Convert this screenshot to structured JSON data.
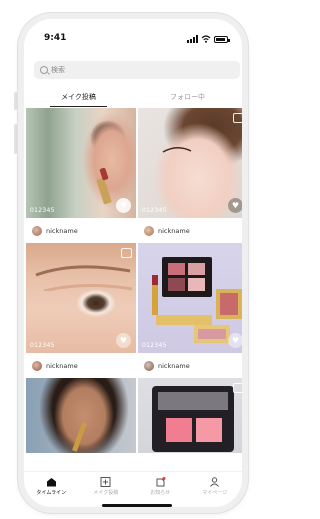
{
  "status": {
    "time": "9:41"
  },
  "search": {
    "placeholder": "検索"
  },
  "tabs": [
    {
      "label": "メイク投稿",
      "active": true
    },
    {
      "label": "フォロー中",
      "active": false
    }
  ],
  "posts": [
    {
      "count": "012345",
      "username": "nickname"
    },
    {
      "count": "012345",
      "username": "nickname"
    },
    {
      "count": "012345",
      "username": "nickname"
    },
    {
      "count": "012345",
      "username": "nickname"
    },
    {
      "count": "",
      "username": ""
    },
    {
      "count": "",
      "username": ""
    }
  ],
  "tabbar": [
    {
      "label": "タイムライン",
      "icon": "home-icon",
      "active": true
    },
    {
      "label": "メイク投稿",
      "icon": "plus-square-icon",
      "active": false
    },
    {
      "label": "お知らせ",
      "icon": "notification-icon",
      "active": false
    },
    {
      "label": "マイページ",
      "icon": "person-icon",
      "active": false
    }
  ],
  "colors": {
    "accent": "#111111",
    "heart_icon": "#ffffff"
  }
}
